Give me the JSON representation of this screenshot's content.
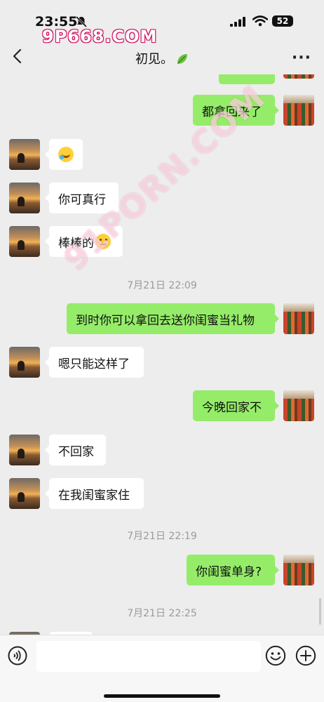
{
  "status": {
    "time": "23:55",
    "battery": "52"
  },
  "watermark": {
    "top": "9P668.COM",
    "diagonal": "91PORN.COM"
  },
  "header": {
    "title": "初见。"
  },
  "messages": [
    {
      "side": "out",
      "text": "都拿回来了"
    },
    {
      "side": "in",
      "emoji": "laugh-cry"
    },
    {
      "side": "in",
      "text": "你可真行"
    },
    {
      "side": "in",
      "text": "棒棒的",
      "emoji": "speechless"
    },
    {
      "timestamp": "7月21日 22:09"
    },
    {
      "side": "out",
      "text": "到时你可以拿回去送你闺蜜当礼物"
    },
    {
      "side": "in",
      "text": "嗯只能这样了"
    },
    {
      "side": "out",
      "text": "今晚回家不"
    },
    {
      "side": "in",
      "text": "不回家"
    },
    {
      "side": "in",
      "text": "在我闺蜜家住"
    },
    {
      "timestamp": "7月21日 22:19"
    },
    {
      "side": "out",
      "text": "你闺蜜单身?"
    },
    {
      "timestamp": "7月21日 22:25"
    }
  ],
  "colors": {
    "outgoing": "#95ec69",
    "incoming": "#ffffff",
    "background": "#ededed"
  }
}
